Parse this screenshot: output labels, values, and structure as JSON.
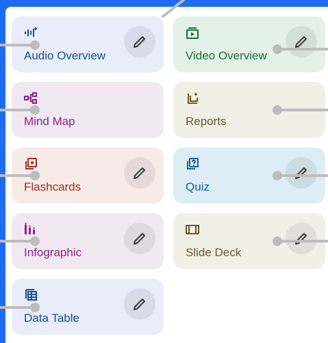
{
  "cards": [
    {
      "label": "Audio Overview",
      "bg": "#e9edfa",
      "color": "#1a4c8c",
      "icon": "audio-waveform-icon",
      "edit": true
    },
    {
      "label": "Video Overview",
      "bg": "#e3f1e7",
      "color": "#1e6b3a",
      "icon": "video-play-icon",
      "edit": true
    },
    {
      "label": "Mind Map",
      "bg": "#f1e8f1",
      "color": "#8a2486",
      "icon": "mind-map-icon",
      "edit": false
    },
    {
      "label": "Reports",
      "bg": "#f0f0e6",
      "color": "#6a5a2a",
      "icon": "reports-sparkle-icon",
      "edit": false
    },
    {
      "label": "Flashcards",
      "bg": "#f7ebe8",
      "color": "#9a2e24",
      "icon": "flashcards-icon",
      "edit": true
    },
    {
      "label": "Quiz",
      "bg": "#dcedf5",
      "color": "#185f8a",
      "icon": "quiz-icon",
      "edit": true
    },
    {
      "label": "Infographic",
      "bg": "#f1e8f1",
      "color": "#8a2486",
      "icon": "infographic-bars-icon",
      "edit": true
    },
    {
      "label": "Slide Deck",
      "bg": "#f0f0e6",
      "color": "#6a5a2a",
      "icon": "slide-deck-icon",
      "edit": true
    },
    {
      "label": "Data Table",
      "bg": "#e9edfa",
      "color": "#1a4c8c",
      "icon": "data-table-icon",
      "edit": true
    }
  ],
  "colors": {
    "accent_border": "#1f6bf5",
    "pencil": "#3a3a3a",
    "connector": "#bdbdbd"
  }
}
